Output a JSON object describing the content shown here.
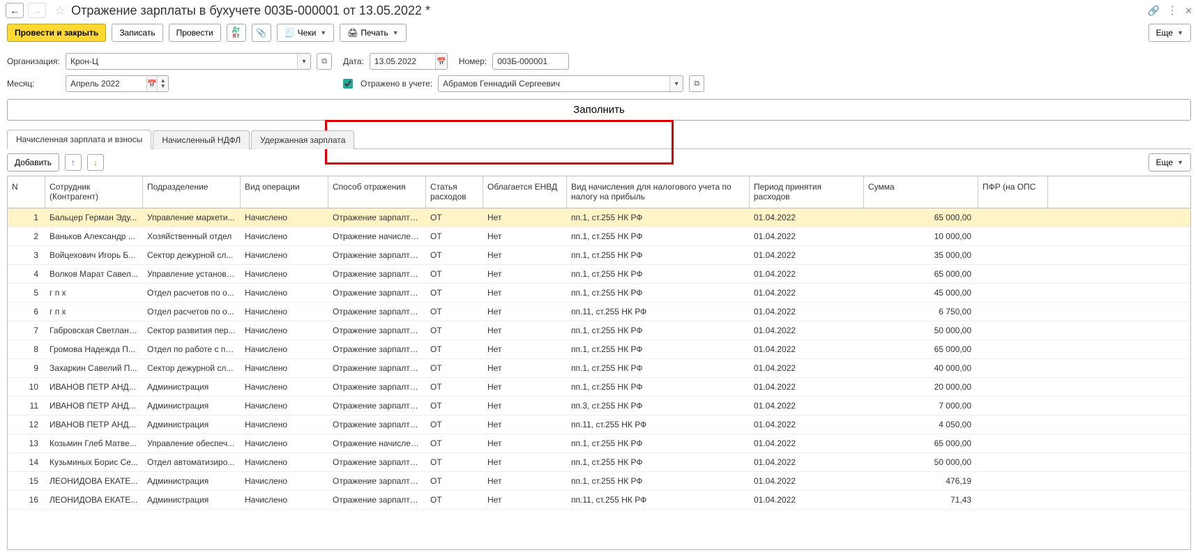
{
  "title": "Отражение зарплаты в бухучете 003Б-000001 от 13.05.2022 *",
  "toolbar": {
    "post_close": "Провести и закрыть",
    "save": "Записать",
    "post": "Провести",
    "checks": "Чеки",
    "print": "Печать",
    "more": "Еще"
  },
  "form": {
    "org_label": "Организация:",
    "org_value": "Крон-Ц",
    "date_label": "Дата:",
    "date_value": "13.05.2022",
    "number_label": "Номер:",
    "number_value": "003Б-000001",
    "month_label": "Месяц:",
    "month_value": "Апрель 2022",
    "reflected_label": "Отражено в учете:",
    "reflected_value": "Абрамов Геннадий Сергеевич",
    "fill_btn": "Заполнить"
  },
  "tabs": {
    "t1": "Начисленная зарплата и взносы",
    "t2": "Начисленный НДФЛ",
    "t3": "Удержанная зарплата"
  },
  "subtoolbar": {
    "add": "Добавить",
    "more": "Еще"
  },
  "columns": {
    "n": "N",
    "emp": "Сотрудник (Контрагент)",
    "dep": "Подразделение",
    "op": "Вид операции",
    "refl": "Способ отражения",
    "cost": "Статья расходов",
    "envd": "Облагается ЕНВД",
    "tax": "Вид начисления для налогового учета по налогу на прибыль",
    "period": "Период принятия расходов",
    "sum": "Сумма",
    "pfr": "ПФР (на ОПС"
  },
  "rows": [
    {
      "n": "1",
      "emp": "Бальцер Герман Эду...",
      "dep": "Управление маркети...",
      "op": "Начислено",
      "refl": "Отражение зарпалты...",
      "cost": "ОТ",
      "envd": "Нет",
      "tax": "пп.1, ст.255 НК РФ",
      "period": "01.04.2022",
      "sum": "65 000,00"
    },
    {
      "n": "2",
      "emp": "Ваньков Александр ...",
      "dep": "Хозяйственный отдел",
      "op": "Начислено",
      "refl": "Отражение начислен...",
      "cost": "ОТ",
      "envd": "Нет",
      "tax": "пп.1, ст.255 НК РФ",
      "period": "01.04.2022",
      "sum": "10 000,00"
    },
    {
      "n": "3",
      "emp": "Войцехович Игорь Б...",
      "dep": "Сектор дежурной сл...",
      "op": "Начислено",
      "refl": "Отражение зарпалты...",
      "cost": "ОТ",
      "envd": "Нет",
      "tax": "пп.1, ст.255 НК РФ",
      "period": "01.04.2022",
      "sum": "35 000,00"
    },
    {
      "n": "4",
      "emp": "Волков Марат Савел...",
      "dep": "Управление установк...",
      "op": "Начислено",
      "refl": "Отражение зарпалты...",
      "cost": "ОТ",
      "envd": "Нет",
      "tax": "пп.1, ст.255 НК РФ",
      "period": "01.04.2022",
      "sum": "65 000,00"
    },
    {
      "n": "5",
      "emp": "г п х",
      "dep": "Отдел расчетов по о...",
      "op": "Начислено",
      "refl": "Отражение зарпалты...",
      "cost": "ОТ",
      "envd": "Нет",
      "tax": "пп.1, ст.255 НК РФ",
      "period": "01.04.2022",
      "sum": "45 000,00"
    },
    {
      "n": "6",
      "emp": "г п х",
      "dep": "Отдел расчетов по о...",
      "op": "Начислено",
      "refl": "Отражение зарпалты...",
      "cost": "ОТ",
      "envd": "Нет",
      "tax": "пп.11, ст.255 НК РФ",
      "period": "01.04.2022",
      "sum": "6 750,00"
    },
    {
      "n": "7",
      "emp": "Габровская Светлана...",
      "dep": "Сектор развития пер...",
      "op": "Начислено",
      "refl": "Отражение зарпалты...",
      "cost": "ОТ",
      "envd": "Нет",
      "tax": "пп.1, ст.255 НК РФ",
      "period": "01.04.2022",
      "sum": "50 000,00"
    },
    {
      "n": "8",
      "emp": "Громова Надежда П...",
      "dep": "Отдел по работе с пе...",
      "op": "Начислено",
      "refl": "Отражение зарпалты...",
      "cost": "ОТ",
      "envd": "Нет",
      "tax": "пп.1, ст.255 НК РФ",
      "period": "01.04.2022",
      "sum": "65 000,00"
    },
    {
      "n": "9",
      "emp": "Захаркин Савелий П...",
      "dep": "Сектор дежурной сл...",
      "op": "Начислено",
      "refl": "Отражение зарпалты...",
      "cost": "ОТ",
      "envd": "Нет",
      "tax": "пп.1, ст.255 НК РФ",
      "period": "01.04.2022",
      "sum": "40 000,00"
    },
    {
      "n": "10",
      "emp": "ИВАНОВ ПЕТР АНД...",
      "dep": "Администрация",
      "op": "Начислено",
      "refl": "Отражение зарпалты...",
      "cost": "ОТ",
      "envd": "Нет",
      "tax": "пп.1, ст.255 НК РФ",
      "period": "01.04.2022",
      "sum": "20 000,00"
    },
    {
      "n": "11",
      "emp": "ИВАНОВ ПЕТР АНД...",
      "dep": "Администрация",
      "op": "Начислено",
      "refl": "Отражение зарпалты...",
      "cost": "ОТ",
      "envd": "Нет",
      "tax": "пп.3, ст.255 НК РФ",
      "period": "01.04.2022",
      "sum": "7 000,00"
    },
    {
      "n": "12",
      "emp": "ИВАНОВ ПЕТР АНД...",
      "dep": "Администрация",
      "op": "Начислено",
      "refl": "Отражение зарпалты...",
      "cost": "ОТ",
      "envd": "Нет",
      "tax": "пп.11, ст.255 НК РФ",
      "period": "01.04.2022",
      "sum": "4 050,00"
    },
    {
      "n": "13",
      "emp": "Козьмин Глеб Матве...",
      "dep": "Управление обеспеч...",
      "op": "Начислено",
      "refl": "Отражение начислен...",
      "cost": "ОТ",
      "envd": "Нет",
      "tax": "пп.1, ст.255 НК РФ",
      "period": "01.04.2022",
      "sum": "65 000,00"
    },
    {
      "n": "14",
      "emp": "Кузьминых Борис Се...",
      "dep": "Отдел автоматизиро...",
      "op": "Начислено",
      "refl": "Отражение зарпалты...",
      "cost": "ОТ",
      "envd": "Нет",
      "tax": "пп.1, ст.255 НК РФ",
      "period": "01.04.2022",
      "sum": "50 000,00"
    },
    {
      "n": "15",
      "emp": "ЛЕОНИДОВА ЕКАТЕ...",
      "dep": "Администрация",
      "op": "Начислено",
      "refl": "Отражение зарпалты...",
      "cost": "ОТ",
      "envd": "Нет",
      "tax": "пп.1, ст.255 НК РФ",
      "period": "01.04.2022",
      "sum": "476,19"
    },
    {
      "n": "16",
      "emp": "ЛЕОНИДОВА ЕКАТЕ...",
      "dep": "Администрация",
      "op": "Начислено",
      "refl": "Отражение зарпалты...",
      "cost": "ОТ",
      "envd": "Нет",
      "tax": "пп.11, ст.255 НК РФ",
      "period": "01.04.2022",
      "sum": "71,43"
    }
  ]
}
